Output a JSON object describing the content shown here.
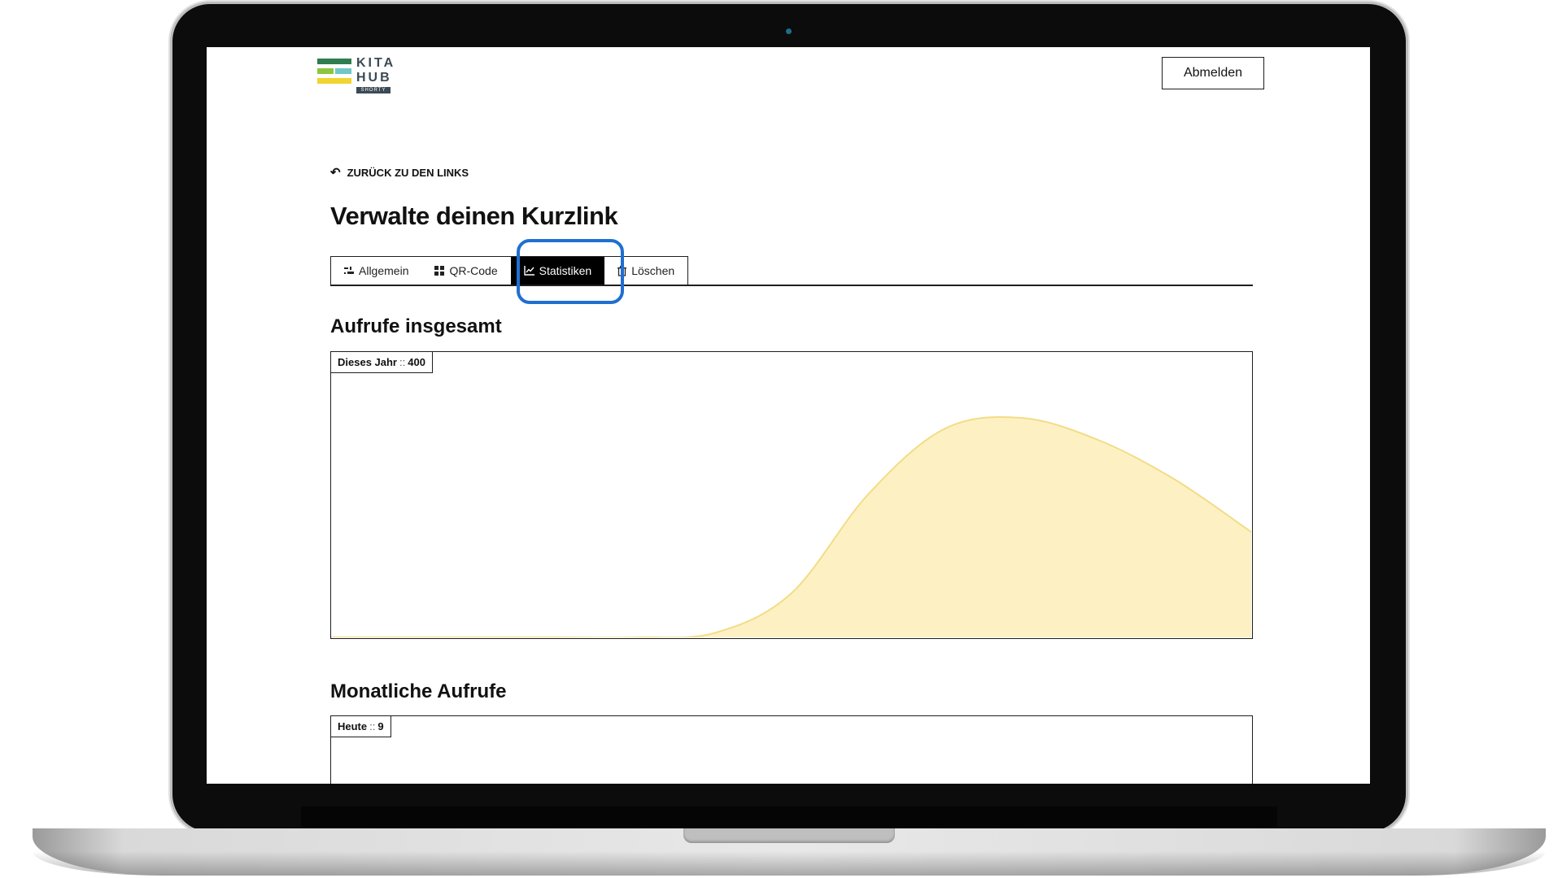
{
  "app": {
    "logo_text_1": "KITA",
    "logo_text_2": "HUB",
    "logo_sub": "SHORTY",
    "logout_label": "Abmelden"
  },
  "nav": {
    "back_label": "ZURÜCK ZU DEN LINKS",
    "page_title": "Verwalte deinen Kurzlink"
  },
  "tabs": [
    {
      "label": "Allgemein",
      "icon": "sliders-icon",
      "active": false
    },
    {
      "label": "QR-Code",
      "icon": "qr-grid-icon",
      "active": false
    },
    {
      "label": "Statistiken",
      "icon": "line-chart-icon",
      "active": true
    },
    {
      "label": "Löschen",
      "icon": "trash-icon",
      "active": false
    }
  ],
  "sections": {
    "total": {
      "title": "Aufrufe insgesamt",
      "badge_label": "Dieses Jahr",
      "badge_sep": "::",
      "badge_value": "400"
    },
    "monthly": {
      "title": "Monatliche Aufrufe",
      "badge_label": "Heute",
      "badge_sep": "::",
      "badge_value": "9"
    }
  },
  "colors": {
    "highlight": "#1f6fd1",
    "area_fill": "#fdf1c4",
    "area_stroke": "#f3dc86",
    "logo_green": "#2f7d4f",
    "logo_lightgreen": "#8cc63f",
    "logo_teal": "#6fc7c7",
    "logo_yellow": "#f1d431"
  },
  "chart_data": {
    "type": "area",
    "x": [
      0,
      1,
      2,
      3,
      4,
      5,
      6,
      7,
      8,
      9,
      10,
      11,
      12
    ],
    "values": [
      0,
      0,
      0,
      0,
      0,
      0.02,
      0.2,
      0.65,
      0.95,
      1.0,
      0.9,
      0.72,
      0.48
    ],
    "title": "",
    "xlabel": "",
    "ylabel": "",
    "ylim": [
      0,
      1.3
    ],
    "grid": false
  }
}
